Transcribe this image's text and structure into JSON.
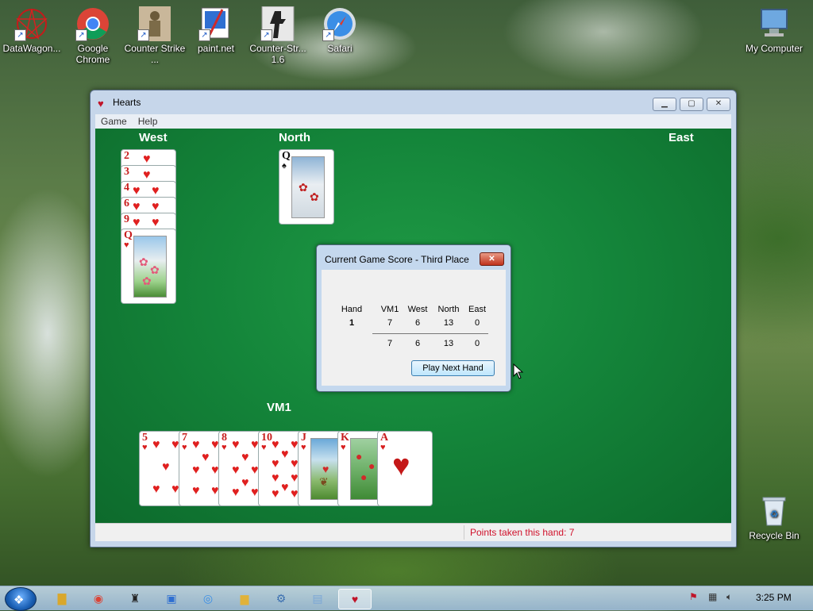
{
  "desktop": {
    "icons": [
      {
        "label": "DataWagon...",
        "icon": "datawagon-icon"
      },
      {
        "label": "Google Chrome",
        "icon": "chrome-icon"
      },
      {
        "label": "Counter Strike ...",
        "icon": "counter-strike-icon"
      },
      {
        "label": "paint.net",
        "icon": "paintnet-icon"
      },
      {
        "label": "Counter-Str... 1.6",
        "icon": "counter-strike-16-icon"
      },
      {
        "label": "Safari",
        "icon": "safari-icon"
      },
      {
        "label": "My Computer",
        "icon": "computer-icon"
      },
      {
        "label": "Recycle Bin",
        "icon": "recycle-bin-icon"
      }
    ]
  },
  "window": {
    "title": "Hearts",
    "menu": [
      "Game",
      "Help"
    ],
    "status": "Points taken this hand: 7"
  },
  "players": {
    "west": "West",
    "north": "North",
    "east": "East",
    "south": "VM1"
  },
  "west_cards": [
    {
      "rank": "2",
      "suit": "♥"
    },
    {
      "rank": "3",
      "suit": "♥"
    },
    {
      "rank": "4",
      "suit": "♥"
    },
    {
      "rank": "6",
      "suit": "♥"
    },
    {
      "rank": "9",
      "suit": "♥"
    },
    {
      "rank": "Q",
      "suit": "♥"
    }
  ],
  "north_card": {
    "rank": "Q",
    "suit": "♠"
  },
  "hand_cards": [
    {
      "rank": "5",
      "suit": "♥"
    },
    {
      "rank": "7",
      "suit": "♥"
    },
    {
      "rank": "8",
      "suit": "♥"
    },
    {
      "rank": "10",
      "suit": "♥"
    },
    {
      "rank": "J",
      "suit": "♥"
    },
    {
      "rank": "K",
      "suit": "♥"
    },
    {
      "rank": "A",
      "suit": "♥"
    }
  ],
  "dialog": {
    "title": "Current Game Score - Third Place",
    "close": "✕",
    "headers": [
      "Hand",
      "VM1",
      "West",
      "North",
      "East"
    ],
    "hand_number": "1",
    "hand_scores": [
      "7",
      "6",
      "13",
      "0"
    ],
    "totals": [
      "7",
      "6",
      "13",
      "0"
    ],
    "button": "Play Next Hand"
  },
  "taskbar": {
    "clock": "3:25 PM"
  },
  "colors": {
    "felt": "#14853a",
    "status_text": "#d0112b",
    "heart": "#e0201f"
  }
}
